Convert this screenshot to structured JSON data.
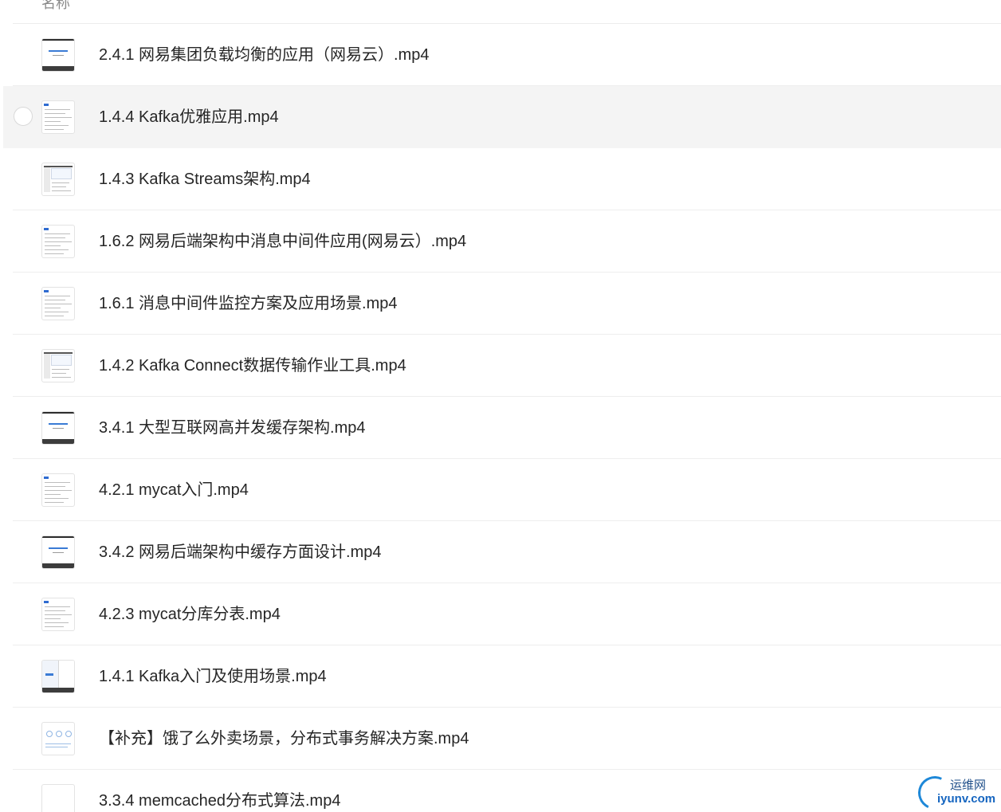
{
  "header": {
    "column_label": "名称"
  },
  "files": [
    {
      "name": "2.4.1 网易集团负载均衡的应用（网易云）.mp4",
      "thumb": "title"
    },
    {
      "name": "1.4.4 Kafka优雅应用.mp4",
      "thumb": "doc",
      "hovered": true
    },
    {
      "name": "1.4.3 Kafka Streams架构.mp4",
      "thumb": "screen"
    },
    {
      "name": "1.6.2 网易后端架构中消息中间件应用(网易云）.mp4",
      "thumb": "doc"
    },
    {
      "name": "1.6.1 消息中间件监控方案及应用场景.mp4",
      "thumb": "doc"
    },
    {
      "name": "1.4.2 Kafka Connect数据传输作业工具.mp4",
      "thumb": "screen"
    },
    {
      "name": "3.4.1 大型互联网高并发缓存架构.mp4",
      "thumb": "title"
    },
    {
      "name": "4.2.1 mycat入门.mp4",
      "thumb": "doc"
    },
    {
      "name": "3.4.2 网易后端架构中缓存方面设计.mp4",
      "thumb": "title"
    },
    {
      "name": "4.2.3 mycat分库分表.mp4",
      "thumb": "doc"
    },
    {
      "name": "1.4.1 Kafka入门及使用场景.mp4",
      "thumb": "split"
    },
    {
      "name": "【补充】饿了么外卖场景，分布式事务解决方案.mp4",
      "thumb": "icons"
    },
    {
      "name": "3.3.4 memcached分布式算法.mp4",
      "thumb": "blank"
    }
  ],
  "watermark": {
    "top_text": "运维网",
    "bottom_text": "iyunv.com"
  }
}
